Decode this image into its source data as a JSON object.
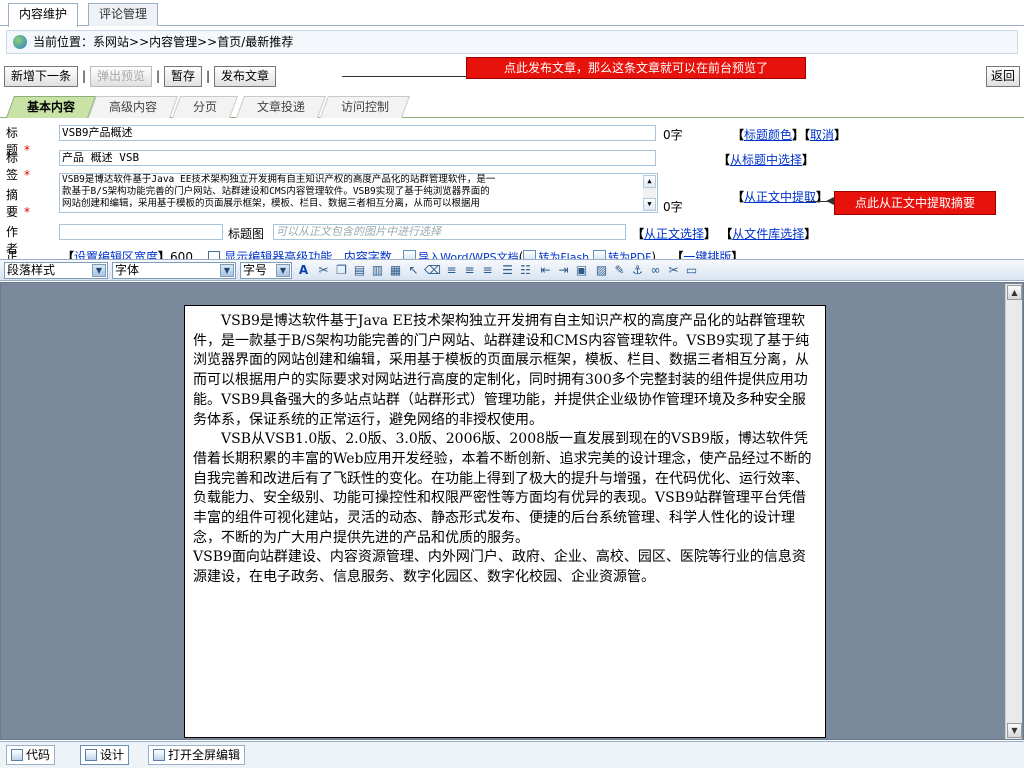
{
  "top_tabs": [
    "内容维护",
    "评论管理"
  ],
  "location": {
    "label": "当前位置：",
    "path": "系网站>>内容管理>>首页/最新推荐"
  },
  "toolbar": {
    "save_next": "新增下一条",
    "preview": "弹出预览",
    "draft": "暂存",
    "publish": "发布文章",
    "back": "返回",
    "sep": "|"
  },
  "callouts": {
    "publish_note": "点此发布文章，那么这条文章就可以在前台预览了",
    "extract_note": "点此从正文中提取摘要"
  },
  "sub_tabs": [
    "基本内容",
    "高级内容",
    "分页",
    "文章投递",
    "访问控制"
  ],
  "form": {
    "title": {
      "label": "标 题",
      "required": "*",
      "value": "VSB9产品概述",
      "count": "0字",
      "color_link": "标题颜色",
      "cancel_link": "取消"
    },
    "tags": {
      "label": "标 签",
      "required": "*",
      "value": "产品 概述 VSB",
      "from_title_link": "从标题中选择"
    },
    "summary": {
      "label": "摘 要",
      "required": "*",
      "line1": "VSB9是博达软件基于Java EE技术架构独立开发拥有自主知识产权的高度产品化的站群管理软件，是一",
      "line2": "款基于B/S架构功能完善的门户网站、站群建设和CMS内容管理软件。VSB9实现了基于纯浏览器界面的",
      "line3": "网站创建和编辑，采用基于模板的页面展示框架，模板、栏目、数据三者相互分离，从而可以根据用",
      "count": "0字",
      "extract_link": "从正文中提取"
    },
    "author": {
      "label": "作 者",
      "value": "",
      "image_label": "标题图",
      "image_hint": "可以从正文包含的图片中进行选择",
      "from_body_link": "从正文选择",
      "from_lib_link": "从文件库选择"
    },
    "body": {
      "label": "正 文",
      "required": "*",
      "set_width_link": "设置编辑区宽度",
      "width": "600",
      "advanced_label": "显示编辑器高级功能",
      "word_count_link": "内容字数",
      "import_link": "导入Word/WPS文档",
      "flash_link": "转为Flash",
      "pdf_link": "转为PDF",
      "typeset_link": "一键排版"
    }
  },
  "editor": {
    "paragraph_style": "段落样式",
    "font": "字体",
    "size": "字号",
    "paragraphs": [
      {
        "indent": true,
        "text": "VSB9是博达软件基于Java EE技术架构独立开发拥有自主知识产权的高度产品化的站群管理软件，是一款基于B/S架构功能完善的门户网站、站群建设和CMS内容管理软件。VSB9实现了基于纯浏览器界面的网站创建和编辑，采用基于模板的页面展示框架，模板、栏目、数据三者相互分离，从而可以根据用户的实际要求对网站进行高度的定制化，同时拥有300多个完整封装的组件提供应用功能。VSB9具备强大的多站点站群（站群形式）管理功能，并提供企业级协作管理环境及多种安全服务体系，保证系统的正常运行，避免网络的非授权使用。"
      },
      {
        "indent": true,
        "text": "VSB从VSB1.0版、2.0版、3.0版、2006版、2008版一直发展到现在的VSB9版，博达软件凭借着长期积累的丰富的Web应用开发经验，本着不断创新、追求完美的设计理念，使产品经过不断的自我完善和改进后有了飞跃性的变化。在功能上得到了极大的提升与增强，在代码优化、运行效率、负载能力、安全级别、功能可操控性和权限严密性等方面均有优异的表现。VSB9站群管理平台凭借丰富的组件可视化建站，灵活的动态、静态形式发布、便捷的后台系统管理、科学人性化的设计理念，不断的为广大用户提供先进的产品和优质的服务。"
      },
      {
        "indent": false,
        "text": "VSB9面向站群建设、内容资源管理、内外网门户、政府、企业、高校、园区、医院等行业的信息资源建设，在电子政务、信息服务、数字化园区、数字化校园、企业资源管。"
      }
    ]
  },
  "bottom": {
    "code": "代码",
    "design": "设计",
    "fullscreen": "打开全屏编辑"
  }
}
